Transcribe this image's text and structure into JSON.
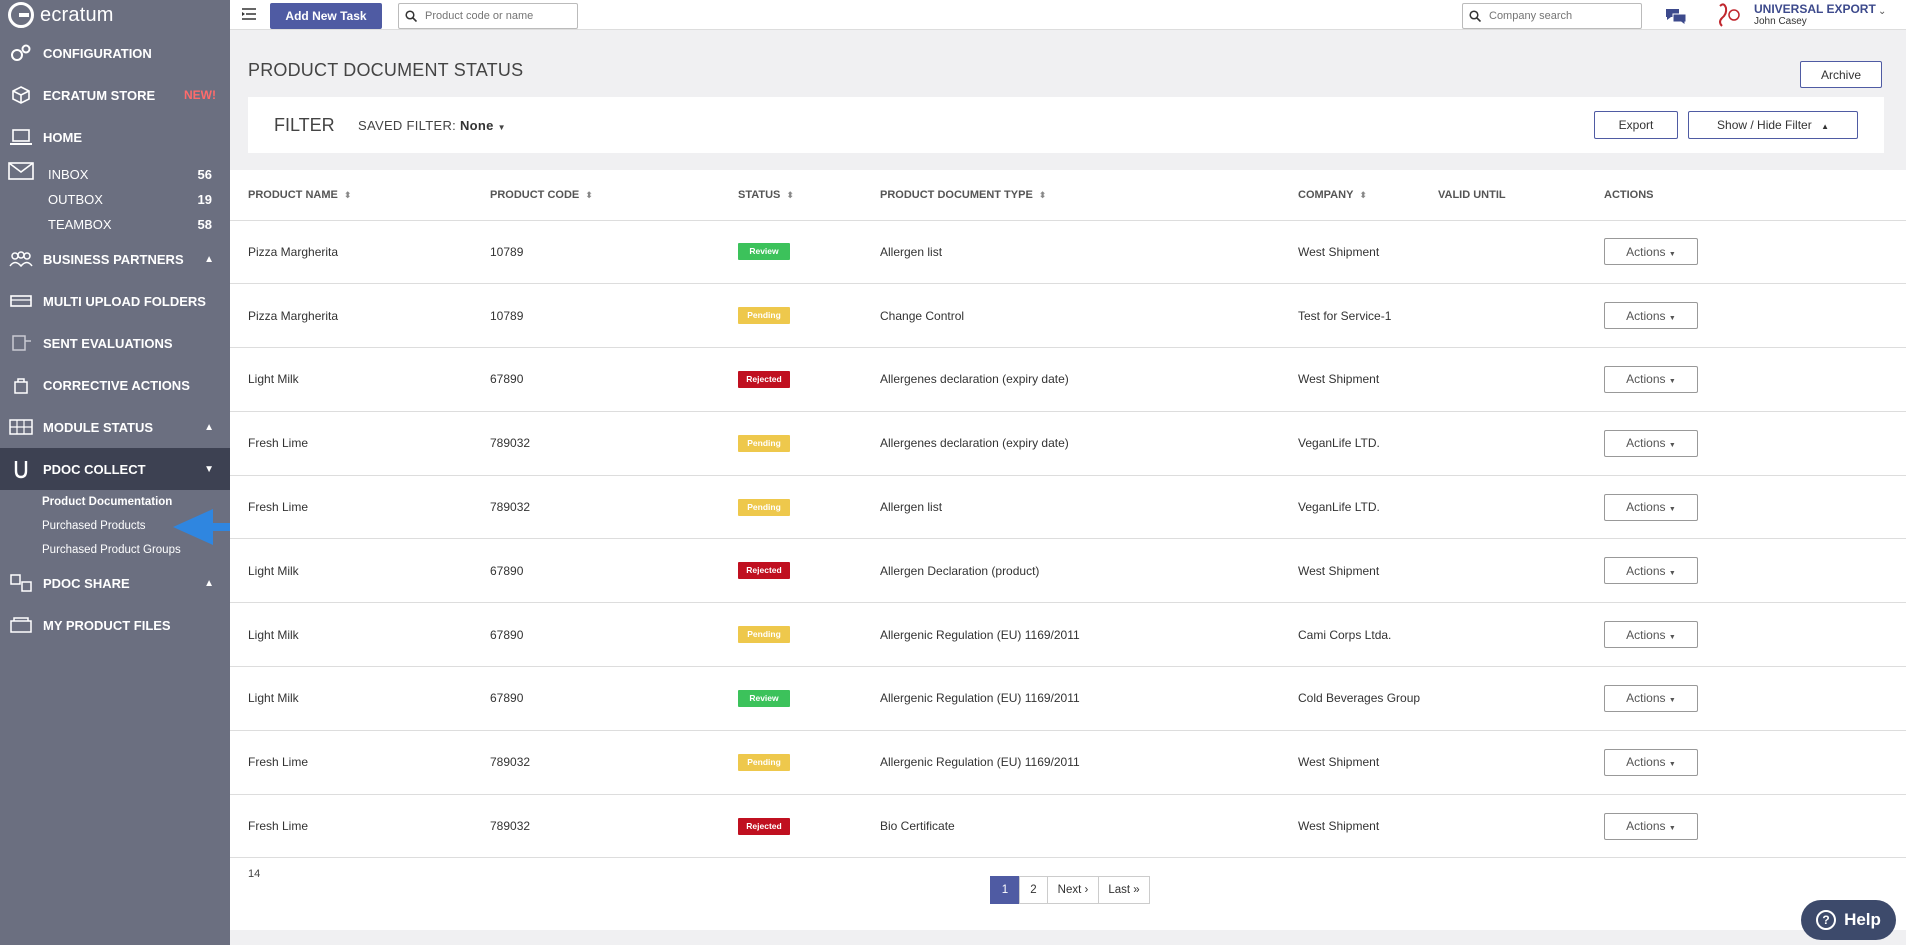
{
  "brand": {
    "name": "ecratum"
  },
  "sidebar": {
    "items": [
      {
        "label": "CONFIGURATION",
        "icon": "gears-icon"
      },
      {
        "label": "ECRATUM STORE",
        "icon": "cubes-icon",
        "badge": "NEW!"
      },
      {
        "label": "HOME",
        "icon": "laptop-icon"
      }
    ],
    "mail": [
      {
        "label": "INBOX",
        "count": "56"
      },
      {
        "label": "OUTBOX",
        "count": "19"
      },
      {
        "label": "TEAMBOX",
        "count": "58"
      }
    ],
    "items2": [
      {
        "label": "BUSINESS PARTNERS",
        "icon": "people-icon",
        "chevron": "^"
      },
      {
        "label": "MULTI UPLOAD FOLDERS",
        "icon": "truck-icon"
      },
      {
        "label": "SENT EVALUATIONS",
        "icon": "clipboard-icon"
      },
      {
        "label": "CORRECTIVE ACTIONS",
        "icon": "lock-icon"
      },
      {
        "label": "MODULE STATUS",
        "icon": "grid-icon",
        "chevron": "^"
      }
    ],
    "pdoc_collect": {
      "label": "PDOC COLLECT",
      "icon": "u-magnet-icon",
      "chevron": "v"
    },
    "pdoc_collect_sub": [
      "Product Documentation",
      "Purchased Products",
      "Purchased Product Groups"
    ],
    "items3": [
      {
        "label": "PDOC SHARE",
        "icon": "share-icon",
        "chevron": "^"
      },
      {
        "label": "MY PRODUCT FILES",
        "icon": "files-icon"
      }
    ]
  },
  "topbar": {
    "add_task_label": "Add New Task",
    "product_search_placeholder": "Product code or name",
    "company_search_placeholder": "Company search",
    "company_name": "UNIVERSAL EXPORT",
    "user_name": "John Casey"
  },
  "page": {
    "title": "PRODUCT DOCUMENT STATUS",
    "archive_label": "Archive"
  },
  "filter": {
    "title": "FILTER",
    "saved_filter_label": "SAVED FILTER:",
    "saved_filter_value": "None",
    "export_label": "Export",
    "toggle_label": "Show / Hide Filter"
  },
  "table": {
    "columns": [
      "PRODUCT NAME",
      "PRODUCT CODE",
      "STATUS",
      "PRODUCT DOCUMENT TYPE",
      "COMPANY",
      "VALID UNTIL",
      "ACTIONS"
    ],
    "action_label": "Actions",
    "rows": [
      {
        "name": "Pizza Margherita",
        "code": "10789",
        "status": "Review",
        "type": "Allergen list",
        "company": "West Shipment",
        "valid": ""
      },
      {
        "name": "Pizza Margherita",
        "code": "10789",
        "status": "Pending",
        "type": "Change Control",
        "company": "Test for Service-1",
        "valid": ""
      },
      {
        "name": "Light Milk",
        "code": "67890",
        "status": "Rejected",
        "type": "Allergenes declaration (expiry date)",
        "company": "West Shipment",
        "valid": ""
      },
      {
        "name": "Fresh Lime",
        "code": "789032",
        "status": "Pending",
        "type": "Allergenes declaration (expiry date)",
        "company": "VeganLife LTD.",
        "valid": ""
      },
      {
        "name": "Fresh Lime",
        "code": "789032",
        "status": "Pending",
        "type": "Allergen list",
        "company": "VeganLife LTD.",
        "valid": ""
      },
      {
        "name": "Light Milk",
        "code": "67890",
        "status": "Rejected",
        "type": "Allergen Declaration (product)",
        "company": "West Shipment",
        "valid": ""
      },
      {
        "name": "Light Milk",
        "code": "67890",
        "status": "Pending",
        "type": "Allergenic Regulation (EU) 1169/2011",
        "company": "Cami Corps Ltda.",
        "valid": ""
      },
      {
        "name": "Light Milk",
        "code": "67890",
        "status": "Review",
        "type": "Allergenic Regulation (EU) 1169/2011",
        "company": "Cold Beverages Group",
        "valid": ""
      },
      {
        "name": "Fresh Lime",
        "code": "789032",
        "status": "Pending",
        "type": "Allergenic Regulation (EU) 1169/2011",
        "company": "West Shipment",
        "valid": ""
      },
      {
        "name": "Fresh Lime",
        "code": "789032",
        "status": "Rejected",
        "type": "Bio Certificate",
        "company": "West Shipment",
        "valid": ""
      }
    ],
    "total": "14"
  },
  "pagination": {
    "pages": [
      "1",
      "2"
    ],
    "next": "Next ›",
    "last": "Last »",
    "current": "1"
  },
  "help": {
    "label": "Help"
  },
  "colors": {
    "sidebar": "#6b6f80",
    "accent": "#4f5ba3",
    "review": "#3cc25b",
    "pending": "#eec84c",
    "rejected": "#c01020",
    "arrow": "#2f86e0"
  }
}
